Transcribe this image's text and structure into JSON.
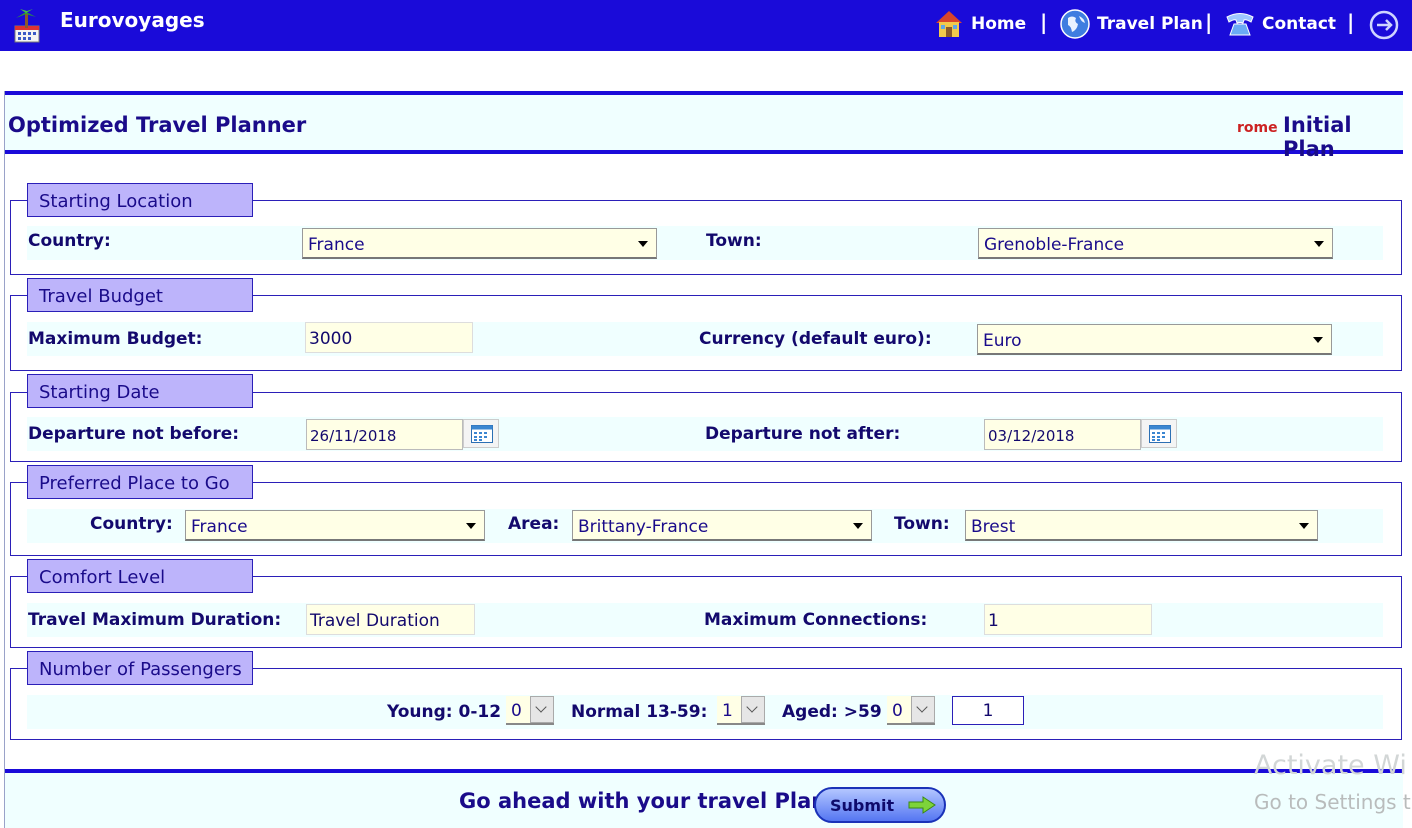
{
  "header": {
    "brand": "Eurovoyages",
    "nav": [
      {
        "label": "Home",
        "icon": "house-icon"
      },
      {
        "label": "Travel Plan",
        "icon": "globe-icon"
      },
      {
        "label": "Contact",
        "icon": "phone-icon"
      }
    ],
    "separator": "|",
    "logout_icon": "logout-icon"
  },
  "panel": {
    "title": "Optimized Travel Planner",
    "user": "rome",
    "plan_label": "Initial Plan"
  },
  "starting_location": {
    "legend": "Starting Location",
    "country_label": "Country:",
    "country_value": "France",
    "town_label": "Town:",
    "town_value": "Grenoble-France"
  },
  "travel_budget": {
    "legend": "Travel Budget",
    "max_label": "Maximum Budget:",
    "max_value": "3000",
    "currency_label": "Currency (default euro):",
    "currency_value": "Euro"
  },
  "starting_date": {
    "legend": "Starting Date",
    "not_before_label": "Departure not before:",
    "not_before_value": "26/11/2018",
    "not_after_label": "Departure not after:",
    "not_after_value": "03/12/2018"
  },
  "preferred_place": {
    "legend": "Preferred Place to Go",
    "country_label": "Country:",
    "country_value": "France",
    "area_label": "Area:",
    "area_value": "Brittany-France",
    "town_label": "Town:",
    "town_value": "Brest"
  },
  "comfort": {
    "legend": "Comfort Level",
    "duration_label": "Travel Maximum Duration:",
    "duration_value": "Travel Duration",
    "connections_label": "Maximum Connections:",
    "connections_value": "1"
  },
  "passengers": {
    "legend": "Number of Passengers",
    "young_label": "Young: 0-12",
    "young_value": "0",
    "normal_label": "Normal 13-59:",
    "normal_value": "1",
    "aged_label": "Aged: >59",
    "aged_value": "0",
    "total": "1"
  },
  "footer": {
    "prompt": "Go ahead with your travel Plan",
    "submit_label": "Submit"
  },
  "watermark": {
    "line1": "Activate Wi",
    "line2": "Go to Settings t"
  },
  "colors": {
    "header_bg": "#1a0bd9",
    "legend_bg": "#bdb4fb",
    "row_bg": "#f0ffff",
    "field_bg": "#ffffe6",
    "label_text": "#13096d",
    "user_red": "#cc2222"
  }
}
